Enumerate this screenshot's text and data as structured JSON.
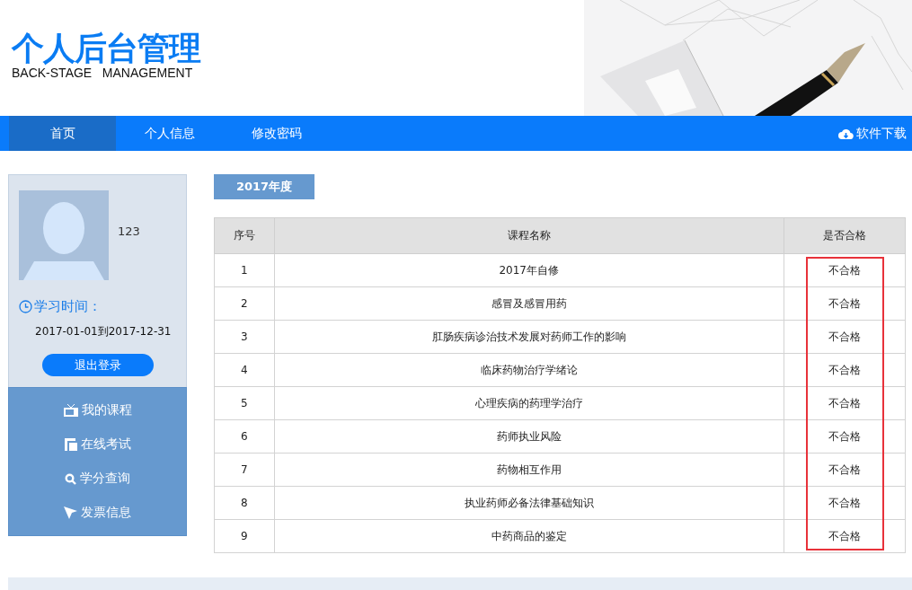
{
  "header": {
    "title": "个人后台管理",
    "subtitle": "BACK-STAGE   MANAGEMENT"
  },
  "nav": {
    "items": [
      {
        "label": "首页",
        "selected": true
      },
      {
        "label": "个人信息",
        "selected": false
      },
      {
        "label": "修改密码",
        "selected": false
      }
    ],
    "download": "软件下载"
  },
  "profile": {
    "name": "123",
    "study_time_label": "学习时间：",
    "study_period": "2017-01-01到2017-12-31",
    "logout": "退出登录"
  },
  "sidebar": {
    "items": [
      {
        "label": "我的课程",
        "kind": "tv"
      },
      {
        "label": "在线考试",
        "kind": "doc"
      },
      {
        "label": "学分查询",
        "kind": "search"
      },
      {
        "label": "发票信息",
        "kind": "plane"
      }
    ]
  },
  "year_tag": "2017年度",
  "table": {
    "columns": [
      "序号",
      "课程名称",
      "是否合格"
    ],
    "highlight_result": true,
    "rows": [
      [
        "1",
        "2017年自修",
        "不合格"
      ],
      [
        "2",
        "感冒及感冒用药",
        "不合格"
      ],
      [
        "3",
        "肛肠疾病诊治技术发展对药师工作的影响",
        "不合格"
      ],
      [
        "4",
        "临床药物治疗学绪论",
        "不合格"
      ],
      [
        "5",
        "心理疾病的药理学治疗",
        "不合格"
      ],
      [
        "6",
        "药师执业风险",
        "不合格"
      ],
      [
        "7",
        "药物相互作用",
        "不合格"
      ],
      [
        "8",
        "执业药师必备法律基础知识",
        "不合格"
      ],
      [
        "9",
        "中药商品的鉴定",
        "不合格"
      ]
    ]
  }
}
